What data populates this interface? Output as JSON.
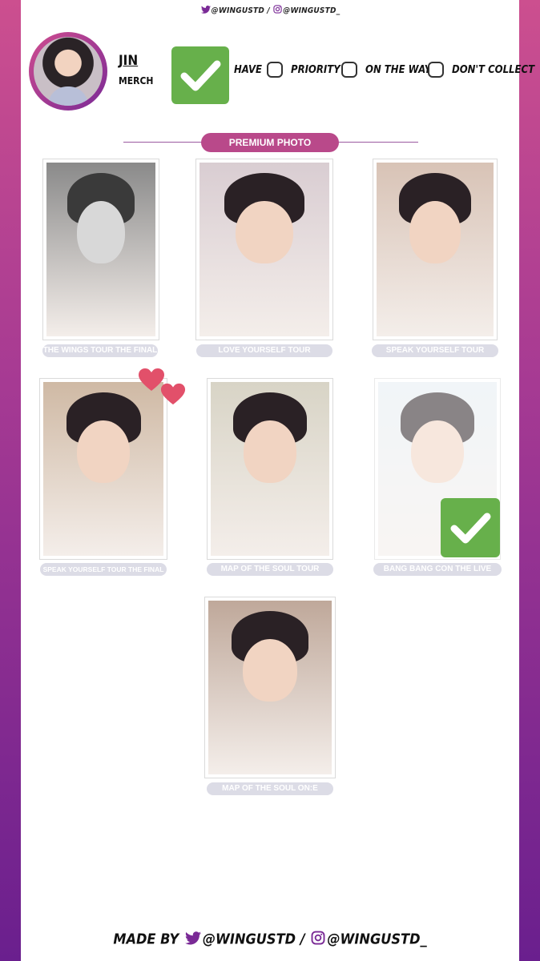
{
  "header": {
    "credit": "@WINGUSTD / @WINGUSTD_",
    "twitter_handle": "@WINGUSTD",
    "separator": "/",
    "instagram_handle": "@WINGUSTD_"
  },
  "profile": {
    "name": "JIN",
    "subtitle": "MERCH"
  },
  "status_options": [
    {
      "label": "HAVE",
      "checked": true
    },
    {
      "label": "PRIORITY",
      "checked": false
    },
    {
      "label": "ON THE WAY",
      "checked": false
    },
    {
      "label": "DON'T COLLECT",
      "checked": false
    }
  ],
  "section": {
    "title": "PREMIUM PHOTO"
  },
  "photos": [
    {
      "caption": "THE WINGS TOUR THE FINAL",
      "tone": "#8a8a8a",
      "owned": false,
      "priority": false
    },
    {
      "caption": "LOVE YOURSELF TOUR",
      "tone": "#d9cdd2",
      "owned": false,
      "priority": false
    },
    {
      "caption": "SPEAK YOURSELF TOUR",
      "tone": "#d8c3b6",
      "owned": false,
      "priority": false
    },
    {
      "caption": "SPEAK YOURSELF TOUR THE FINAL",
      "tone": "#cfb9a4",
      "owned": false,
      "priority": true
    },
    {
      "caption": "MAP OF THE SOUL TOUR",
      "tone": "#d8d4c6",
      "owned": false,
      "priority": false
    },
    {
      "caption": "BANG BANG CON THE LIVE",
      "tone": "#e6eef3",
      "owned": true,
      "priority": false
    },
    {
      "caption": "MAP OF THE SOUL ON:E",
      "tone": "#bfa89a",
      "owned": false,
      "priority": false
    }
  ],
  "footer": {
    "made_by": "MADE BY",
    "twitter_handle": "@WINGUSTD",
    "separator": "/",
    "instagram_handle": "@WINGUSTD_"
  },
  "colors": {
    "accent": "#b9498a",
    "check_green": "#67b04b",
    "caption_bg": "#dcdce6",
    "heart": "#e2506a"
  },
  "icons": [
    "twitter-icon",
    "instagram-icon",
    "check-icon",
    "heart-icon"
  ]
}
